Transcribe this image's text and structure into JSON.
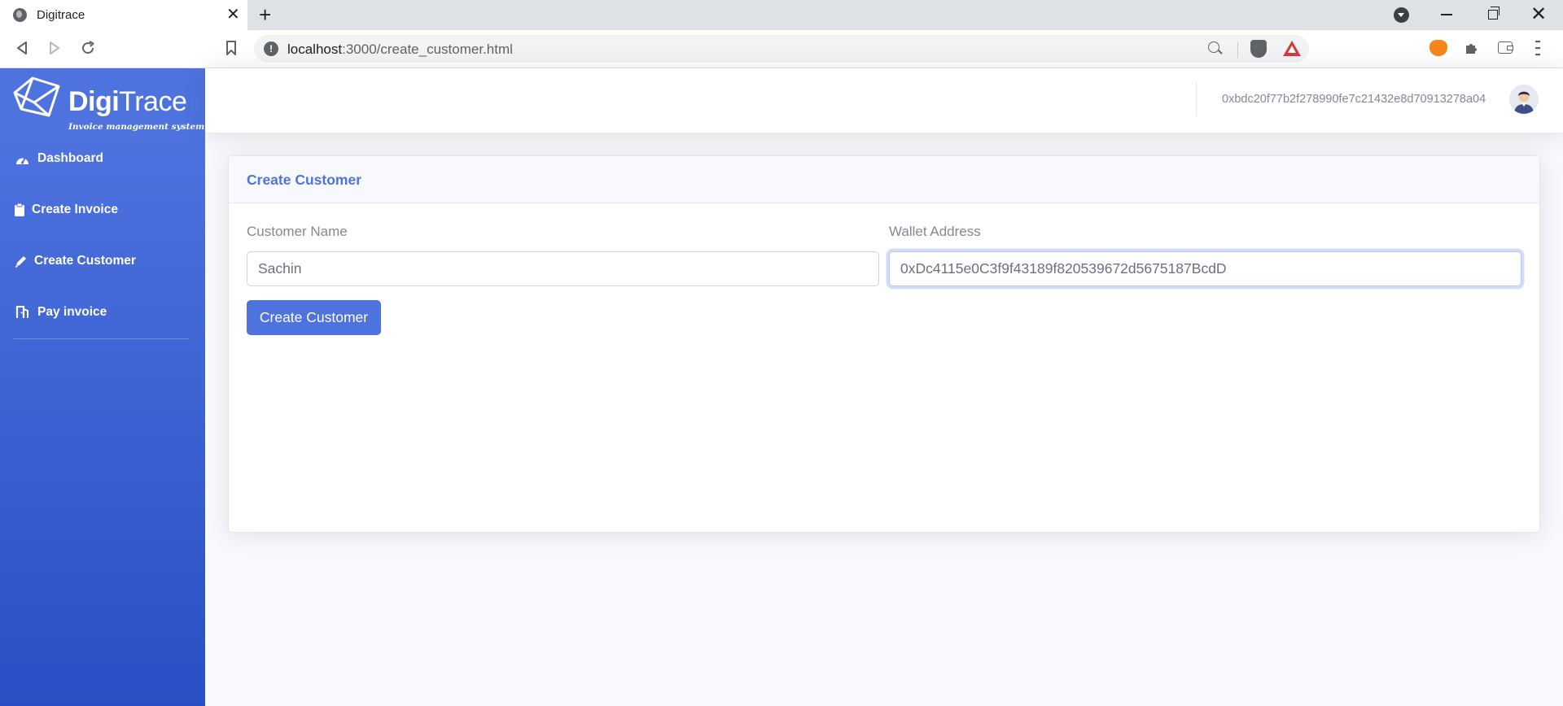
{
  "browser": {
    "tab_title": "Digitrace",
    "tab_close": "✕",
    "new_tab": "+",
    "url_host": "localhost",
    "url_path": ":3000/create_customer.html",
    "window_close": "✕"
  },
  "brand": {
    "name_bold": "Digi",
    "name_light": "Trace",
    "tagline": "Invoice management system"
  },
  "sidebar": {
    "items": [
      {
        "label": "Dashboard",
        "icon": "tachometer-icon"
      },
      {
        "label": "Create Invoice",
        "icon": "clipboard-icon"
      },
      {
        "label": "Create Customer",
        "icon": "pen-icon"
      },
      {
        "label": "Pay invoice",
        "icon": "door-icon"
      }
    ]
  },
  "topbar": {
    "wallet_address": "0xbdc20f77b2f278990fe7c21432e8d70913278a04"
  },
  "form": {
    "title": "Create Customer",
    "customer_name_label": "Customer Name",
    "customer_name_value": "Sachin",
    "wallet_address_label": "Wallet Address",
    "wallet_address_value": "0xDc4115e0C3f9f43189f820539672d5675187BcdD",
    "submit_label": "Create Customer"
  },
  "colors": {
    "primary": "#4e73df",
    "sidebar_gradient_start": "#4e73df",
    "sidebar_gradient_end": "#2a4fc4",
    "muted_text": "#858796"
  }
}
